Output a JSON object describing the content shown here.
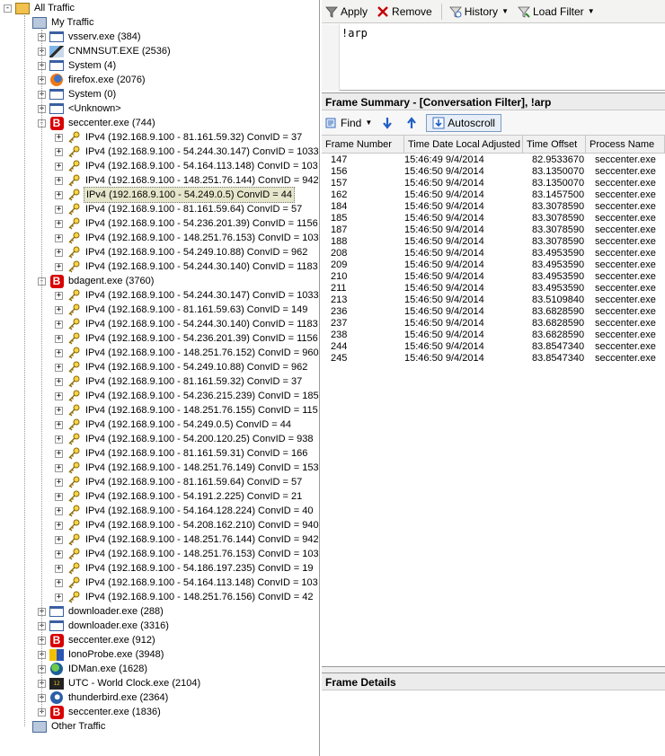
{
  "tree": {
    "root_label": "All Traffic",
    "my_traffic_label": "My Traffic",
    "other_traffic_label": "Other Traffic",
    "processes_top": [
      {
        "label": "vsserv.exe (384)",
        "icon": "window-icon"
      },
      {
        "label": "CNMNSUT.EXE (2536)",
        "icon": "cnm-app-icon"
      },
      {
        "label": "System (4)",
        "icon": "window-icon"
      },
      {
        "label": "firefox.exe (2076)",
        "icon": "firefox-icon"
      },
      {
        "label": "System (0)",
        "icon": "window-icon"
      },
      {
        "label": "<Unknown>",
        "icon": "window-icon"
      }
    ],
    "seccenter": {
      "label": "seccenter.exe (744)",
      "icon": "bitdefender-b-icon",
      "conversations": [
        "IPv4 (192.168.9.100 - 81.161.59.32) ConvID = 37",
        "IPv4 (192.168.9.100 - 54.244.30.147) ConvID = 1033",
        "IPv4 (192.168.9.100 - 54.164.113.148) ConvID = 103",
        "IPv4 (192.168.9.100 - 148.251.76.144) ConvID = 942",
        "IPv4 (192.168.9.100 - 54.249.0.5) ConvID = 44",
        "IPv4 (192.168.9.100 - 81.161.59.64) ConvID = 57",
        "IPv4 (192.168.9.100 - 54.236.201.39) ConvID = 1156",
        "IPv4 (192.168.9.100 - 148.251.76.153) ConvID = 103",
        "IPv4 (192.168.9.100 - 54.249.10.88) ConvID = 962",
        "IPv4 (192.168.9.100 - 54.244.30.140) ConvID = 1183"
      ],
      "selected_index": 4
    },
    "bdagent": {
      "label": "bdagent.exe (3760)",
      "icon": "bitdefender-b-icon",
      "conversations": [
        "IPv4 (192.168.9.100 - 54.244.30.147) ConvID = 1033",
        "IPv4 (192.168.9.100 - 81.161.59.63) ConvID = 149",
        "IPv4 (192.168.9.100 - 54.244.30.140) ConvID = 1183",
        "IPv4 (192.168.9.100 - 54.236.201.39) ConvID = 1156",
        "IPv4 (192.168.9.100 - 148.251.76.152) ConvID = 960",
        "IPv4 (192.168.9.100 - 54.249.10.88) ConvID = 962",
        "IPv4 (192.168.9.100 - 81.161.59.32) ConvID = 37",
        "IPv4 (192.168.9.100 - 54.236.215.239) ConvID = 185",
        "IPv4 (192.168.9.100 - 148.251.76.155) ConvID = 115",
        "IPv4 (192.168.9.100 - 54.249.0.5) ConvID = 44",
        "IPv4 (192.168.9.100 - 54.200.120.25) ConvID = 938",
        "IPv4 (192.168.9.100 - 81.161.59.31) ConvID = 166",
        "IPv4 (192.168.9.100 - 148.251.76.149) ConvID = 153",
        "IPv4 (192.168.9.100 - 81.161.59.64) ConvID = 57",
        "IPv4 (192.168.9.100 - 54.191.2.225) ConvID = 21",
        "IPv4 (192.168.9.100 - 54.164.128.224) ConvID = 40",
        "IPv4 (192.168.9.100 - 54.208.162.210) ConvID = 940",
        "IPv4 (192.168.9.100 - 148.251.76.144) ConvID = 942",
        "IPv4 (192.168.9.100 - 148.251.76.153) ConvID = 103",
        "IPv4 (192.168.9.100 - 54.186.197.235) ConvID = 19",
        "IPv4 (192.168.9.100 - 54.164.113.148) ConvID = 103",
        "IPv4 (192.168.9.100 - 148.251.76.156) ConvID = 42"
      ]
    },
    "processes_bottom": [
      {
        "label": "downloader.exe (288)",
        "icon": "window-icon"
      },
      {
        "label": "downloader.exe (3316)",
        "icon": "window-icon"
      },
      {
        "label": "seccenter.exe (912)",
        "icon": "bitdefender-b-icon"
      },
      {
        "label": "IonoProbe.exe (3948)",
        "icon": "ionoprobe-icon"
      },
      {
        "label": "IDMan.exe (1628)",
        "icon": "idman-globe-icon"
      },
      {
        "label": "UTC - World Clock.exe (2104)",
        "icon": "world-clock-icon"
      },
      {
        "label": "thunderbird.exe (2364)",
        "icon": "thunderbird-icon"
      },
      {
        "label": "seccenter.exe (1836)",
        "icon": "bitdefender-b-icon"
      }
    ]
  },
  "filter_toolbar": {
    "apply_label": "Apply",
    "remove_label": "Remove",
    "history_label": "History",
    "load_filter_label": "Load Filter"
  },
  "filter_text": "!arp",
  "frame_summary": {
    "title": "Frame Summary - [Conversation Filter], !arp",
    "find_label": "Find",
    "autoscroll_label": "Autoscroll",
    "columns": [
      "Frame Number",
      "Time Date Local Adjusted",
      "Time Offset",
      "Process Name"
    ],
    "rows": [
      [
        "147",
        "15:46:49 9/4/2014",
        "82.9533670",
        "seccenter.exe"
      ],
      [
        "156",
        "15:46:50 9/4/2014",
        "83.1350070",
        "seccenter.exe"
      ],
      [
        "157",
        "15:46:50 9/4/2014",
        "83.1350070",
        "seccenter.exe"
      ],
      [
        "162",
        "15:46:50 9/4/2014",
        "83.1457500",
        "seccenter.exe"
      ],
      [
        "184",
        "15:46:50 9/4/2014",
        "83.3078590",
        "seccenter.exe"
      ],
      [
        "185",
        "15:46:50 9/4/2014",
        "83.3078590",
        "seccenter.exe"
      ],
      [
        "187",
        "15:46:50 9/4/2014",
        "83.3078590",
        "seccenter.exe"
      ],
      [
        "188",
        "15:46:50 9/4/2014",
        "83.3078590",
        "seccenter.exe"
      ],
      [
        "208",
        "15:46:50 9/4/2014",
        "83.4953590",
        "seccenter.exe"
      ],
      [
        "209",
        "15:46:50 9/4/2014",
        "83.4953590",
        "seccenter.exe"
      ],
      [
        "210",
        "15:46:50 9/4/2014",
        "83.4953590",
        "seccenter.exe"
      ],
      [
        "211",
        "15:46:50 9/4/2014",
        "83.4953590",
        "seccenter.exe"
      ],
      [
        "213",
        "15:46:50 9/4/2014",
        "83.5109840",
        "seccenter.exe"
      ],
      [
        "236",
        "15:46:50 9/4/2014",
        "83.6828590",
        "seccenter.exe"
      ],
      [
        "237",
        "15:46:50 9/4/2014",
        "83.6828590",
        "seccenter.exe"
      ],
      [
        "238",
        "15:46:50 9/4/2014",
        "83.6828590",
        "seccenter.exe"
      ],
      [
        "244",
        "15:46:50 9/4/2014",
        "83.8547340",
        "seccenter.exe"
      ],
      [
        "245",
        "15:46:50 9/4/2014",
        "83.8547340",
        "seccenter.exe"
      ]
    ]
  },
  "frame_details": {
    "title": "Frame Details"
  }
}
